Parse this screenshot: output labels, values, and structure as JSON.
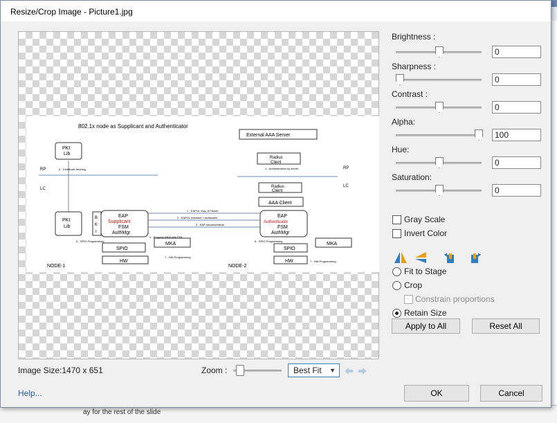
{
  "dialog": {
    "title": "Resize/Crop Image - Picture1.jpg"
  },
  "adjustments": [
    {
      "label": "Brightness :",
      "value": "0"
    },
    {
      "label": "Sharpness :",
      "value": "0"
    },
    {
      "label": "Contrast :",
      "value": "0"
    },
    {
      "label": "Alpha:",
      "value": "100"
    },
    {
      "label": "Hue:",
      "value": "0"
    },
    {
      "label": "Saturation:",
      "value": "0"
    }
  ],
  "options": {
    "gray_scale": "Gray Scale",
    "invert_color": "Invert Color",
    "fit_to_stage": "Fit to Stage",
    "crop": "Crop",
    "constrain_proportions": "Constrain proportions",
    "retain_size": "Retain Size",
    "selected_mode": "Retain Size"
  },
  "buttons": {
    "apply_all": "Apply to All",
    "reset_all": "Reset All",
    "ok": "OK",
    "cancel": "Cancel"
  },
  "status": {
    "image_size": "Image Size:1470 x 651",
    "zoom_label": "Zoom :",
    "zoom_value": "Best Fit"
  },
  "help": "Help...",
  "diagram": {
    "title": "802.1x node as Supplicant and Authenticator",
    "rp": "RP",
    "lc": "LC",
    "node1": "NODE-1",
    "node2": "NODE-2",
    "pki_lib_1": [
      "PKI",
      "Lib"
    ],
    "pki_lib_2": [
      "PKI",
      "Lib"
    ],
    "eap1": [
      "EAP",
      "Supplicant",
      "FSM",
      "AuthMgr"
    ],
    "eap2": [
      "EAP",
      "Authenticator",
      "FSM",
      "AuthMgr"
    ],
    "external": "External AAA Server",
    "radius_client_1": [
      "Radius",
      "Client"
    ],
    "radius_client_2": [
      "Radius",
      "Client"
    ],
    "aaa_client": "AAA Client",
    "spio": "SPIO",
    "mka": "MKA",
    "hw": "HW",
    "bk": [
      "B",
      "K",
      "I"
    ],
    "arrow1": "1 - EAPOL msg. 8 Packet",
    "arrow2": "2 - EAPOL Interface / certificates",
    "arrow3": "3 - EAP success/failure",
    "cert": "6 - Certificate fetching",
    "auth_server": "4 - Authentication by server",
    "mka_prog": "4 - Program MKA with PSK",
    "spio_prog": "6 - SPIO Programming",
    "hw_prog": "7 - HW Programming"
  },
  "background": {
    "bottom_text": "ay for the rest of the slide"
  }
}
